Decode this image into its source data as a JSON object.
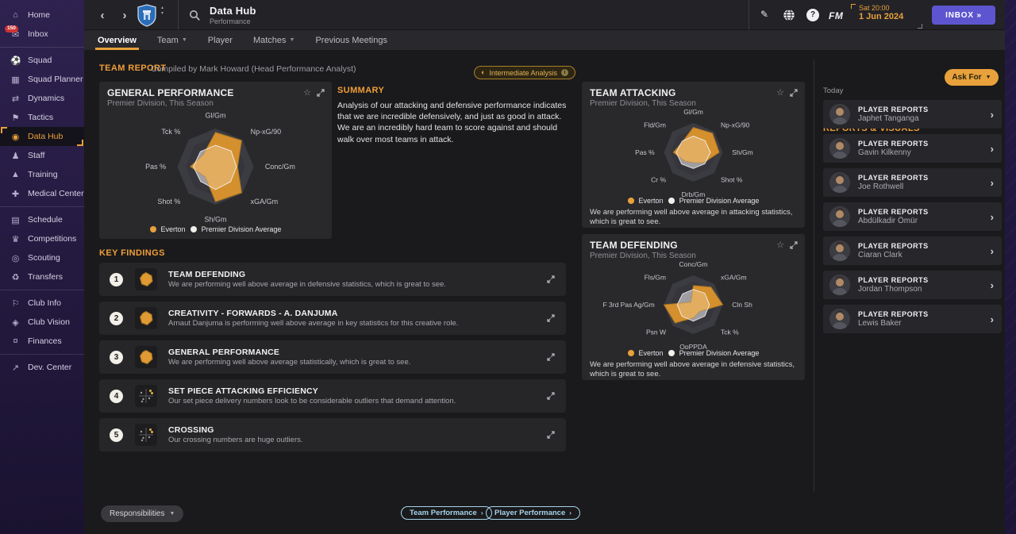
{
  "titlebar": {
    "title": "Data Hub",
    "subtitle": "Performance",
    "back": "‹",
    "forward": "›",
    "fm_logo": "FM",
    "help": "?",
    "clock": "Sat 20:00",
    "date": "1 Jun 2024",
    "inbox_label": "INBOX",
    "inbox_chevrons": "»"
  },
  "tabs": [
    {
      "label": "Overview",
      "active": true,
      "dropdown": false
    },
    {
      "label": "Team",
      "active": false,
      "dropdown": true
    },
    {
      "label": "Player",
      "active": false,
      "dropdown": false
    },
    {
      "label": "Matches",
      "active": false,
      "dropdown": true
    },
    {
      "label": "Previous Meetings",
      "active": false,
      "dropdown": false
    }
  ],
  "sidebar": {
    "items": [
      {
        "label": "Home",
        "icon": "home-icon"
      },
      {
        "label": "Inbox",
        "icon": "inbox-icon",
        "badge": "150",
        "sep_after": true
      },
      {
        "label": "Squad",
        "icon": "squad-icon"
      },
      {
        "label": "Squad Planner",
        "icon": "squad-planner-icon"
      },
      {
        "label": "Dynamics",
        "icon": "dynamics-icon"
      },
      {
        "label": "Tactics",
        "icon": "tactics-icon"
      },
      {
        "label": "Data Hub",
        "icon": "data-hub-icon",
        "active": true
      },
      {
        "label": "Staff",
        "icon": "staff-icon"
      },
      {
        "label": "Training",
        "icon": "training-icon"
      },
      {
        "label": "Medical Center",
        "icon": "medical-icon",
        "sep_after": true
      },
      {
        "label": "Schedule",
        "icon": "schedule-icon"
      },
      {
        "label": "Competitions",
        "icon": "competitions-icon"
      },
      {
        "label": "Scouting",
        "icon": "scouting-icon"
      },
      {
        "label": "Transfers",
        "icon": "transfers-icon",
        "sep_after": true
      },
      {
        "label": "Club Info",
        "icon": "club-info-icon"
      },
      {
        "label": "Club Vision",
        "icon": "club-vision-icon"
      },
      {
        "label": "Finances",
        "icon": "finances-icon",
        "sep_after": true
      },
      {
        "label": "Dev. Center",
        "icon": "dev-center-icon"
      }
    ]
  },
  "report": {
    "header_label": "TEAM REPORT",
    "compiled_by": "Compiled by Mark Howard (Head Performance Analyst)",
    "analysis_badge": "Intermediate Analysis",
    "info_glyph": "i",
    "summary_label": "SUMMARY",
    "summary_text": "Analysis of our attacking and defensive performance indicates that we are incredible defensively, and just as good in attack. We are an incredibly hard team to score against and should walk over most teams in attack."
  },
  "key_findings": {
    "label": "KEY FINDINGS",
    "items": [
      {
        "num": "1",
        "icon": "radar-chart-icon",
        "title": "TEAM DEFENDING",
        "desc": "We are performing well above average in defensive statistics, which is great to see."
      },
      {
        "num": "2",
        "icon": "radar-chart-icon",
        "title": "CREATIVITY - FORWARDS - A. DANJUMA",
        "desc": "Arnaut Danjuma is performing well above average in key statistics for this creative role."
      },
      {
        "num": "3",
        "icon": "radar-chart-icon",
        "title": "GENERAL PERFORMANCE",
        "desc": "We are performing well above average statistically, which is great to see."
      },
      {
        "num": "4",
        "icon": "scatter-chart-icon",
        "title": "SET PIECE ATTACKING EFFICIENCY",
        "desc": "Our set piece delivery numbers look to be considerable outliers that demand attention."
      },
      {
        "num": "5",
        "icon": "scatter-chart-icon",
        "title": "CROSSING",
        "desc": "Our crossing numbers are huge outliers."
      }
    ]
  },
  "team_performance_header": "TEAM PERFORMANCE",
  "chart_data": [
    {
      "type": "radar",
      "title": "GENERAL PERFORMANCE",
      "subtitle": "Premier Division, This Season",
      "axes": [
        "Gl/Gm",
        "Np-xG/90",
        "Conc/Gm",
        "xGA/Gm",
        "Sh/Gm",
        "Shot %",
        "Pas %",
        "Tck %"
      ],
      "range": [
        0,
        1
      ],
      "series": [
        {
          "name": "Everton",
          "color": "#e9a13b",
          "values": [
            0.9,
            0.97,
            0.58,
            0.97,
            0.92,
            0.38,
            0.66,
            0.45
          ]
        },
        {
          "name": "Premier Division Average",
          "color": "#f2f0ea",
          "values": [
            0.56,
            0.58,
            0.55,
            0.56,
            0.6,
            0.55,
            0.58,
            0.56
          ]
        }
      ],
      "caption": ""
    },
    {
      "type": "radar",
      "title": "TEAM ATTACKING",
      "subtitle": "Premier Division, This Season",
      "axes": [
        "Gl/Gm",
        "Np-xG/90",
        "Sh/Gm",
        "Shot %",
        "Drb/Gm",
        "Cr %",
        "Pas %",
        "Fld/Gm"
      ],
      "range": [
        0,
        1
      ],
      "series": [
        {
          "name": "Everton",
          "color": "#e9a13b",
          "values": [
            0.85,
            0.92,
            0.88,
            0.5,
            0.35,
            0.42,
            0.68,
            0.52
          ]
        },
        {
          "name": "Premier Division Average",
          "color": "#f2f0ea",
          "values": [
            0.55,
            0.56,
            0.58,
            0.55,
            0.55,
            0.56,
            0.58,
            0.54
          ]
        }
      ],
      "caption": "We are performing well above average in attacking statistics, which is great to see."
    },
    {
      "type": "radar",
      "title": "TEAM DEFENDING",
      "subtitle": "Premier Division, This Season",
      "axes": [
        "Conc/Gm",
        "xGA/Gm",
        "Cln Sh",
        "Tck %",
        "OpPPDA",
        "Psn W",
        "F 3rd Pas Ag/Gm",
        "Fls/Gm"
      ],
      "range": [
        0,
        1
      ],
      "series": [
        {
          "name": "Everton",
          "color": "#e9a13b",
          "values": [
            0.65,
            0.85,
            1.0,
            0.32,
            0.45,
            0.88,
            1.0,
            0.12
          ]
        },
        {
          "name": "Premier Division Average",
          "color": "#f2f0ea",
          "values": [
            0.52,
            0.55,
            0.55,
            0.55,
            0.56,
            0.55,
            0.55,
            0.52
          ]
        }
      ],
      "caption": "We are performing well above average in defensive statistics, which is great to see."
    }
  ],
  "reports_visuals": {
    "label": "REPORTS & VISUALS",
    "ask_for": "Ask For",
    "today": "Today",
    "items": [
      {
        "category": "PLAYER REPORTS",
        "name": "Japhet Tanganga"
      },
      {
        "category": "PLAYER REPORTS",
        "name": "Gavin Kilkenny"
      },
      {
        "category": "PLAYER REPORTS",
        "name": "Joe Rothwell"
      },
      {
        "category": "PLAYER REPORTS",
        "name": "Abdülkadir Ömür"
      },
      {
        "category": "PLAYER REPORTS",
        "name": "Ciaran Clark"
      },
      {
        "category": "PLAYER REPORTS",
        "name": "Jordan Thompson"
      },
      {
        "category": "PLAYER REPORTS",
        "name": "Lewis Baker"
      }
    ]
  },
  "footer": {
    "responsibilities": "Responsibilities",
    "team_performance": "Team Performance",
    "player_performance": "Player Performance"
  }
}
